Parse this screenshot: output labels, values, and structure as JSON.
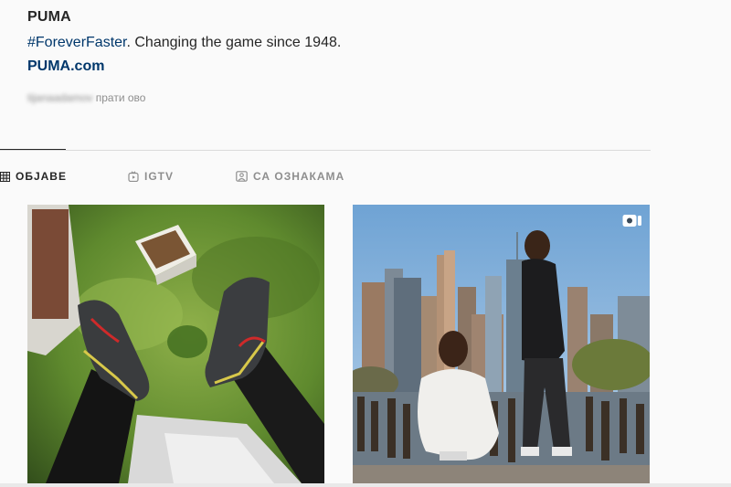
{
  "profile": {
    "name": "PUMA",
    "hashtag": "#ForeverFaster",
    "tagline": ". Changing the game since 1948.",
    "website": "PUMA.com"
  },
  "followed_by": {
    "username": "tijanaadamov",
    "suffix": "прати ово"
  },
  "tabs": [
    {
      "label": "ОБЈАВЕ",
      "icon": "grid-icon",
      "active": true
    },
    {
      "label": "IGTV",
      "icon": "igtv-icon",
      "active": false
    },
    {
      "label": "СА ОЗНАКАМА",
      "icon": "tagged-icon",
      "active": false
    }
  ],
  "posts": [
    {
      "subject": "sneakers-on-rooftop",
      "type": "image"
    },
    {
      "subject": "two-men-city-skyline",
      "type": "video",
      "badge": "video-icon"
    }
  ],
  "colors": {
    "link": "#00376b",
    "text": "#262626",
    "muted": "#8e8e8e",
    "background": "#fafafa"
  }
}
